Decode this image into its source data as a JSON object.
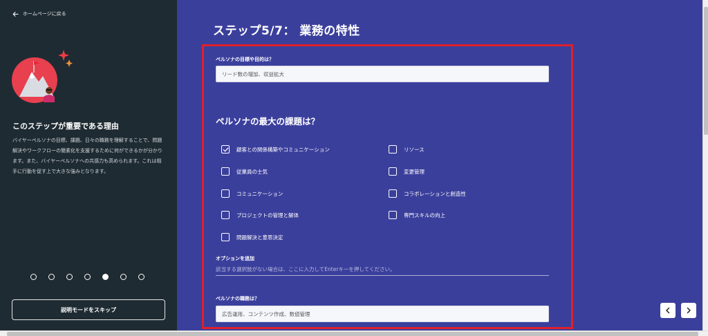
{
  "sidebar": {
    "back_label": "ホームページに戻る",
    "heading": "このステップが重要である理由",
    "body": "バイヤーペルソナの目標、課題、日々の職務を理解することで、問題解決やワークフローの簡素化を支援するために何ができるかが分かります。また、バイヤーペルソナへの共感力も高められます。これは相手に行動を促す上で大きな強みとなります。",
    "steps_total": 7,
    "active_step": 5,
    "skip_label": "説明モードをスキップ"
  },
  "main": {
    "title": "ステップ5/7： 業務の特性",
    "goal": {
      "label": "ペルソナの目標や目的は？",
      "value": "リード数の増加、収益拡大"
    },
    "challenges": {
      "heading": "ペルソナの最大の課題は？",
      "options": [
        {
          "label": "顧客との関係構築やコミュニケーション",
          "checked": true
        },
        {
          "label": "リソース",
          "checked": false
        },
        {
          "label": "従業員の士気",
          "checked": false
        },
        {
          "label": "変更管理",
          "checked": false
        },
        {
          "label": "コミュニケーション",
          "checked": false
        },
        {
          "label": "コラボレーションと創造性",
          "checked": false
        },
        {
          "label": "プロジェクトの管理と解体",
          "checked": false
        },
        {
          "label": "専門スキルの向上",
          "checked": false
        },
        {
          "label": "問題解決と意思決定",
          "checked": false
        }
      ],
      "add_option_label": "オプションを追加",
      "add_option_placeholder": "該当する選択肢がない場合は、ここに入力してEnterキーを押してください。"
    },
    "duties": {
      "label": "ペルソナの職務は？",
      "value": "広告運用、コンテンツ作成、数値管理"
    }
  },
  "colors": {
    "sidebar_bg": "#1f2b33",
    "main_bg": "#3b3f9c",
    "highlight_border": "#e0202a"
  }
}
